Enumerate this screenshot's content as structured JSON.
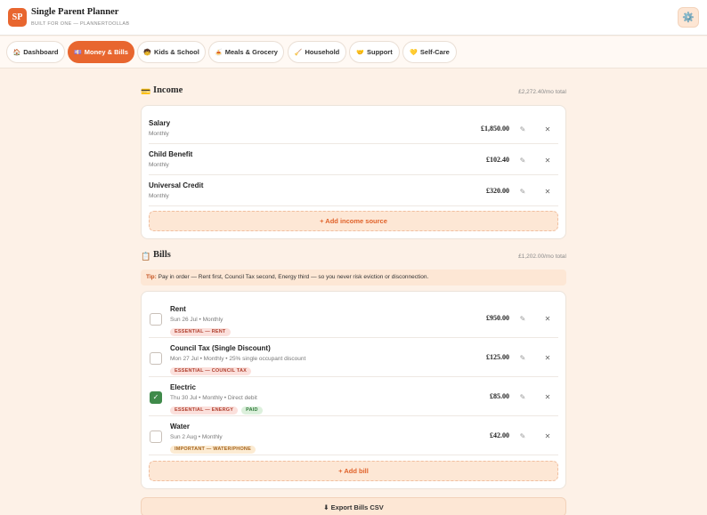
{
  "app": {
    "logo": "SP",
    "title": "Single Parent Planner",
    "subtitle": "BUILT FOR ONE — PLANNERTOOLLAB",
    "settings_icon": "⚙️"
  },
  "nav": {
    "tabs": [
      {
        "icon": "🏠",
        "label": "Dashboard",
        "active": false
      },
      {
        "icon": "💷",
        "label": "Money & Bills",
        "active": true
      },
      {
        "icon": "🧒",
        "label": "Kids & School",
        "active": false
      },
      {
        "icon": "🍝",
        "label": "Meals & Grocery",
        "active": false
      },
      {
        "icon": "🧹",
        "label": "Household",
        "active": false
      },
      {
        "icon": "🤝",
        "label": "Support",
        "active": false
      },
      {
        "icon": "💛",
        "label": "Self-Care",
        "active": false
      }
    ]
  },
  "income": {
    "icon": "💳",
    "title": "Income",
    "total": "£2,272.40/mo total",
    "rows": [
      {
        "name": "Salary",
        "freq": "Monthly",
        "amount": "£1,850.00"
      },
      {
        "name": "Child Benefit",
        "freq": "Monthly",
        "amount": "£102.40"
      },
      {
        "name": "Universal Credit",
        "freq": "Monthly",
        "amount": "£320.00"
      }
    ],
    "add_label": "+ Add income source"
  },
  "bills": {
    "icon": "📋",
    "title": "Bills",
    "total": "£1,202.00/mo total",
    "tip_label": "Tip:",
    "tip_text": " Pay in order — Rent first, Council Tax second, Energy third — so you never risk eviction or disconnection.",
    "rows": [
      {
        "name": "Rent",
        "detail": "Sun 26 Jul • Monthly",
        "amount": "£950.00",
        "paid": false,
        "badges": [
          {
            "text": "ESSENTIAL — RENT",
            "kind": "ess"
          }
        ]
      },
      {
        "name": "Council Tax (Single Discount)",
        "detail": "Mon 27 Jul • Monthly • 25% single occupant discount",
        "amount": "£125.00",
        "paid": false,
        "badges": [
          {
            "text": "ESSENTIAL — COUNCIL TAX",
            "kind": "ess"
          }
        ]
      },
      {
        "name": "Electric",
        "detail": "Thu 30 Jul • Monthly • Direct debit",
        "amount": "£85.00",
        "paid": true,
        "badges": [
          {
            "text": "ESSENTIAL — ENERGY",
            "kind": "ess"
          },
          {
            "text": "PAID",
            "kind": "paid"
          }
        ]
      },
      {
        "name": "Water",
        "detail": "Sun 2 Aug • Monthly",
        "amount": "£42.00",
        "paid": false,
        "badges": [
          {
            "text": "IMPORTANT — WATER/PHONE",
            "kind": "imp"
          }
        ]
      }
    ],
    "add_label": "+ Add bill",
    "export_label": "⬇ Export Bills CSV"
  },
  "icons": {
    "edit": "✎",
    "delete": "✕",
    "check": "✓"
  },
  "colors": {
    "accent": "#e8662f",
    "paid": "#3f8a4a",
    "background": "#fdf1e7"
  }
}
